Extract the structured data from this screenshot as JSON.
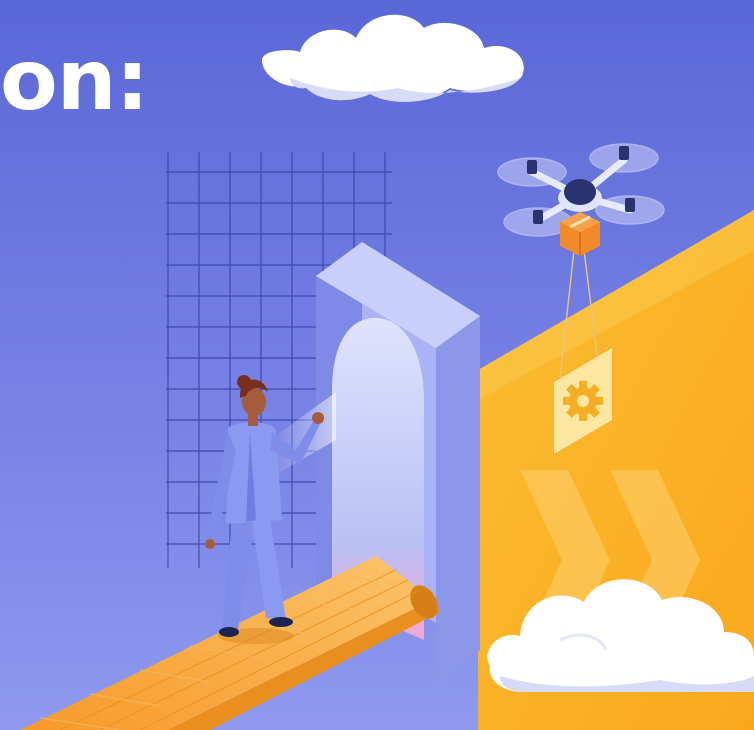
{
  "headline": "on:",
  "colors": {
    "background_top": "#5d6bdc",
    "background_bottom": "#8d98ee",
    "grid_line": "#3a44a8",
    "arch_front": "#a9b3f5",
    "arch_side": "#7f8ae6",
    "arch_top": "#c8cffb",
    "conveyor": "#f7a93a",
    "conveyor_edge": "#e98f1f",
    "wall_yellow": "#fbb62b",
    "wall_yellow_light": "#fcc94d",
    "suit": "#8a9af0",
    "skin": "#a45c3a",
    "hair": "#7a2e1a",
    "cloud": "#ffffff",
    "cloud_shadow": "#d7dbf6",
    "drone_body": "#2b3270",
    "package": "#f28a2b",
    "sign_panel": "#fde9a6",
    "gear": "#f7b12a"
  },
  "icons": {
    "drone": "drone-icon",
    "package": "package-icon",
    "gear": "gear-icon",
    "cloud": "cloud-icon"
  }
}
